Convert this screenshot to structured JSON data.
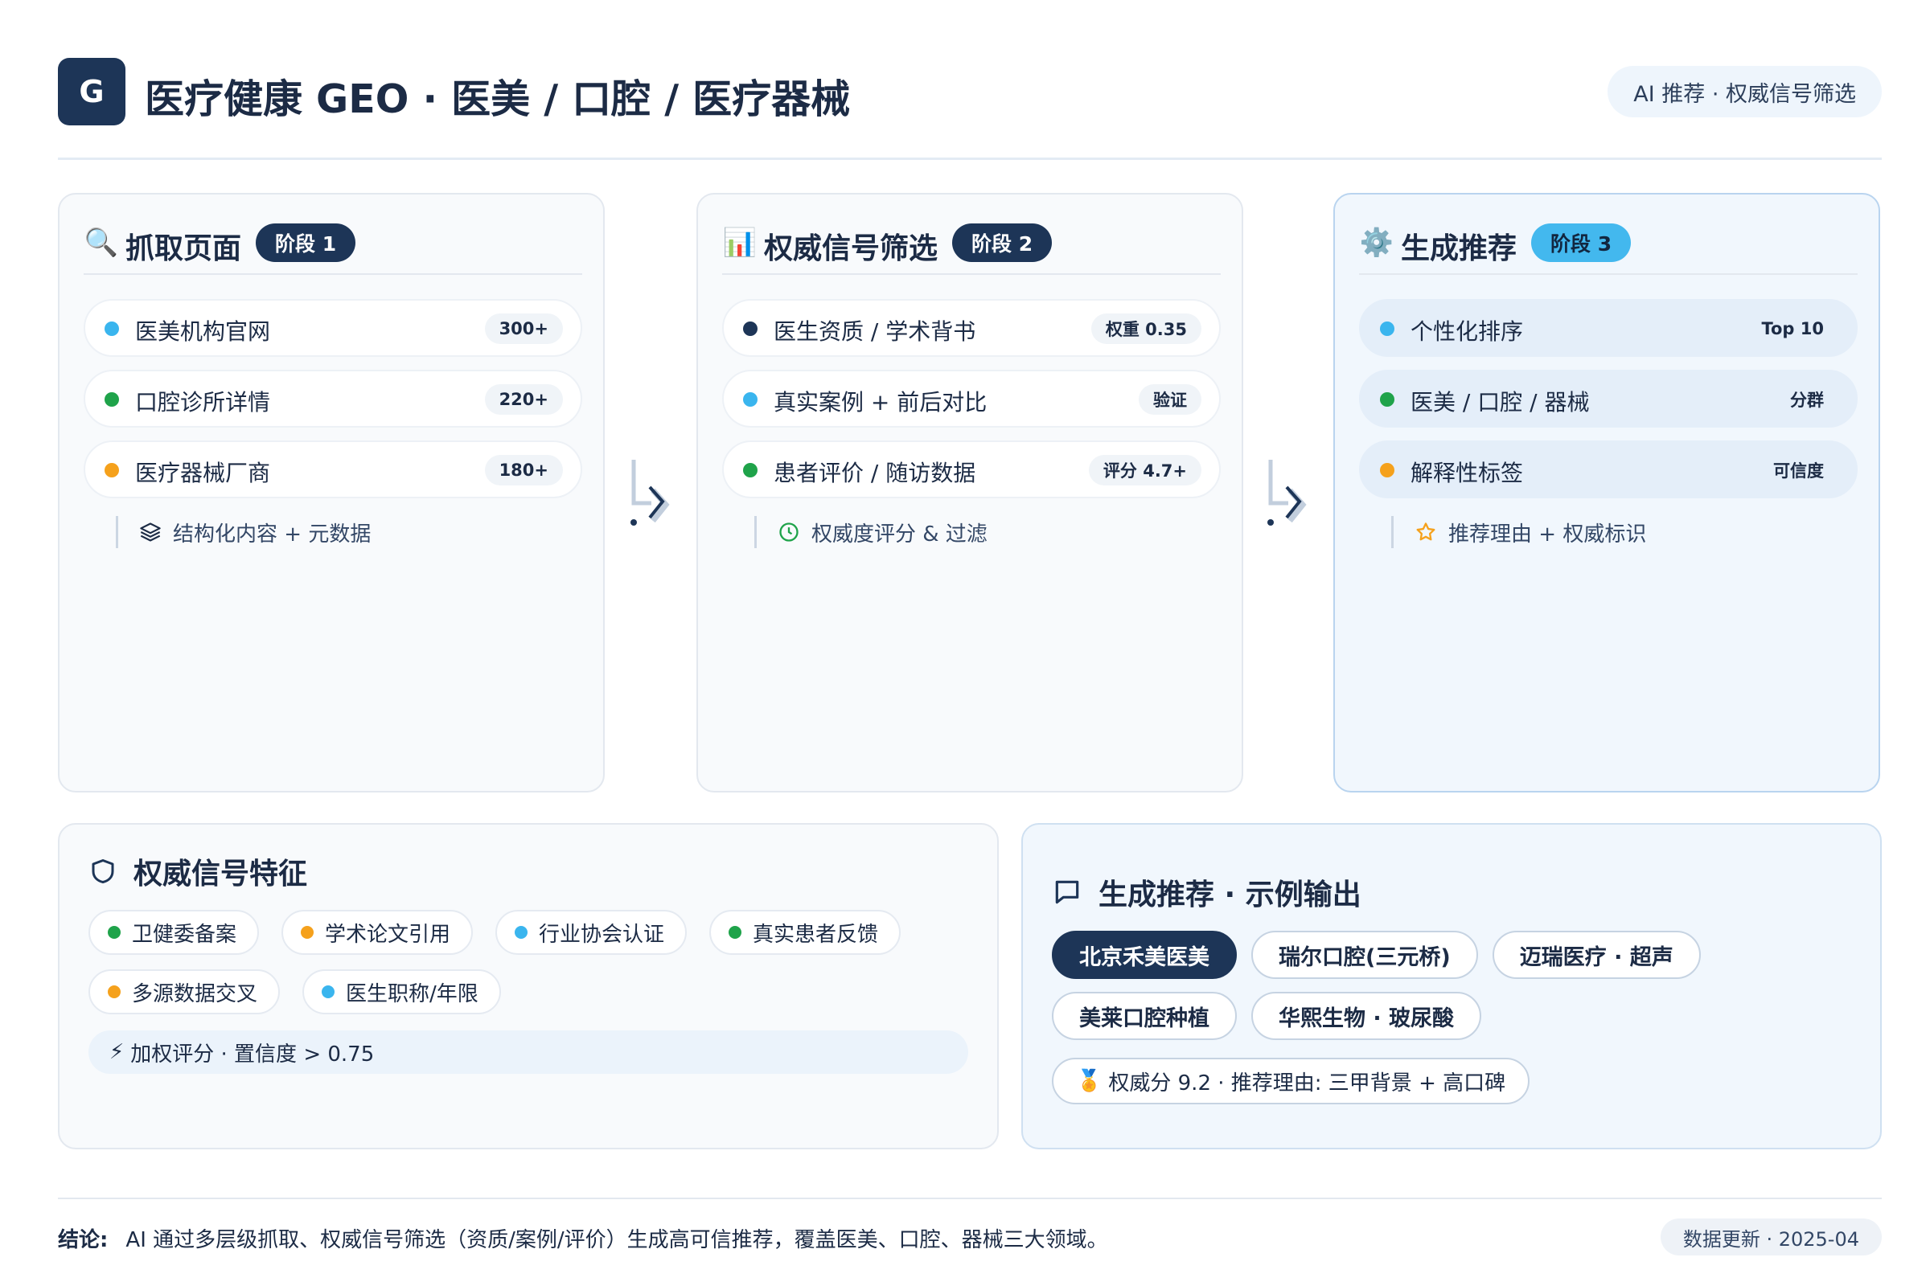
{
  "header": {
    "logo_letter": "G",
    "title": "医疗健康 GEO · 医美 / 口腔 / 医疗器械",
    "badge": "AI 推荐 · 权威信号筛选"
  },
  "stages": [
    {
      "icon": "🔍",
      "title": "抓取页面",
      "pill": "阶段 1",
      "rows": [
        {
          "label": "医美机构官网",
          "tag": "300+",
          "dot_color": "#3ab5ee"
        },
        {
          "label": "口腔诊所详情",
          "tag": "220+",
          "dot_color": "#1fa34a"
        },
        {
          "label": "医疗器械厂商",
          "tag": "180+",
          "dot_color": "#f5a11c"
        }
      ],
      "note": "结构化内容 + 元数据"
    },
    {
      "icon": "📊",
      "title": "权威信号筛选",
      "pill": "阶段 2",
      "rows": [
        {
          "label": "医生资质 / 学术背书",
          "tag": "权重 0.35",
          "dot_color": "#1d3557"
        },
        {
          "label": "真实案例 + 前后对比",
          "tag": "验证",
          "dot_color": "#3ab5ee"
        },
        {
          "label": "患者评价 / 随访数据",
          "tag": "评分 4.7+",
          "dot_color": "#1fa34a"
        }
      ],
      "note": "权威度评分 & 过滤"
    },
    {
      "icon": "⚙️",
      "title": "生成推荐",
      "pill": "阶段 3",
      "rows": [
        {
          "label": "个性化排序",
          "tag": "Top 10",
          "dot_color": "#3ab5ee"
        },
        {
          "label": "医美 / 口腔 / 器械",
          "tag": "分群",
          "dot_color": "#1fa34a"
        },
        {
          "label": "解释性标签",
          "tag": "可信度",
          "dot_color": "#f5a11c"
        }
      ],
      "note": "推荐理由 + 权威标识"
    }
  ],
  "signals": {
    "title": "权威信号特征",
    "chips": [
      {
        "label": "卫健委备案",
        "dot_color": "#1fa34a"
      },
      {
        "label": "学术论文引用",
        "dot_color": "#f5a11c"
      },
      {
        "label": "行业协会认证",
        "dot_color": "#3ab5ee"
      },
      {
        "label": "真实患者反馈",
        "dot_color": "#1fa34a"
      },
      {
        "label": "多源数据交叉",
        "dot_color": "#f5a11c"
      },
      {
        "label": "医生职称/年限",
        "dot_color": "#3ab5ee"
      }
    ],
    "bar_icon": "⚡",
    "bar_text": "加权评分 · 置信度 > 0.75"
  },
  "output": {
    "title": "生成推荐 · 示例输出",
    "chips": [
      "北京禾美医美",
      "瑞尔口腔(三元桥)",
      "迈瑞医疗 · 超声",
      "美莱口腔种植",
      "华熙生物 · 玻尿酸"
    ],
    "score_icon": "🏅",
    "score_text": "权威分 9.2 · 推荐理由: 三甲背景 + 高口碑"
  },
  "footer": {
    "conclusion_label": "结论:",
    "conclusion_text": "AI 通过多层级抓取、权威信号筛选（资质/案例/评价）生成高可信推荐，覆盖医美、口腔、器械三大领域。",
    "update": "数据更新 · 2025-04"
  },
  "colors": {
    "primary": "#1d3557",
    "accent": "#43b8ee",
    "green": "#1fa34a",
    "orange": "#f5a11c"
  }
}
